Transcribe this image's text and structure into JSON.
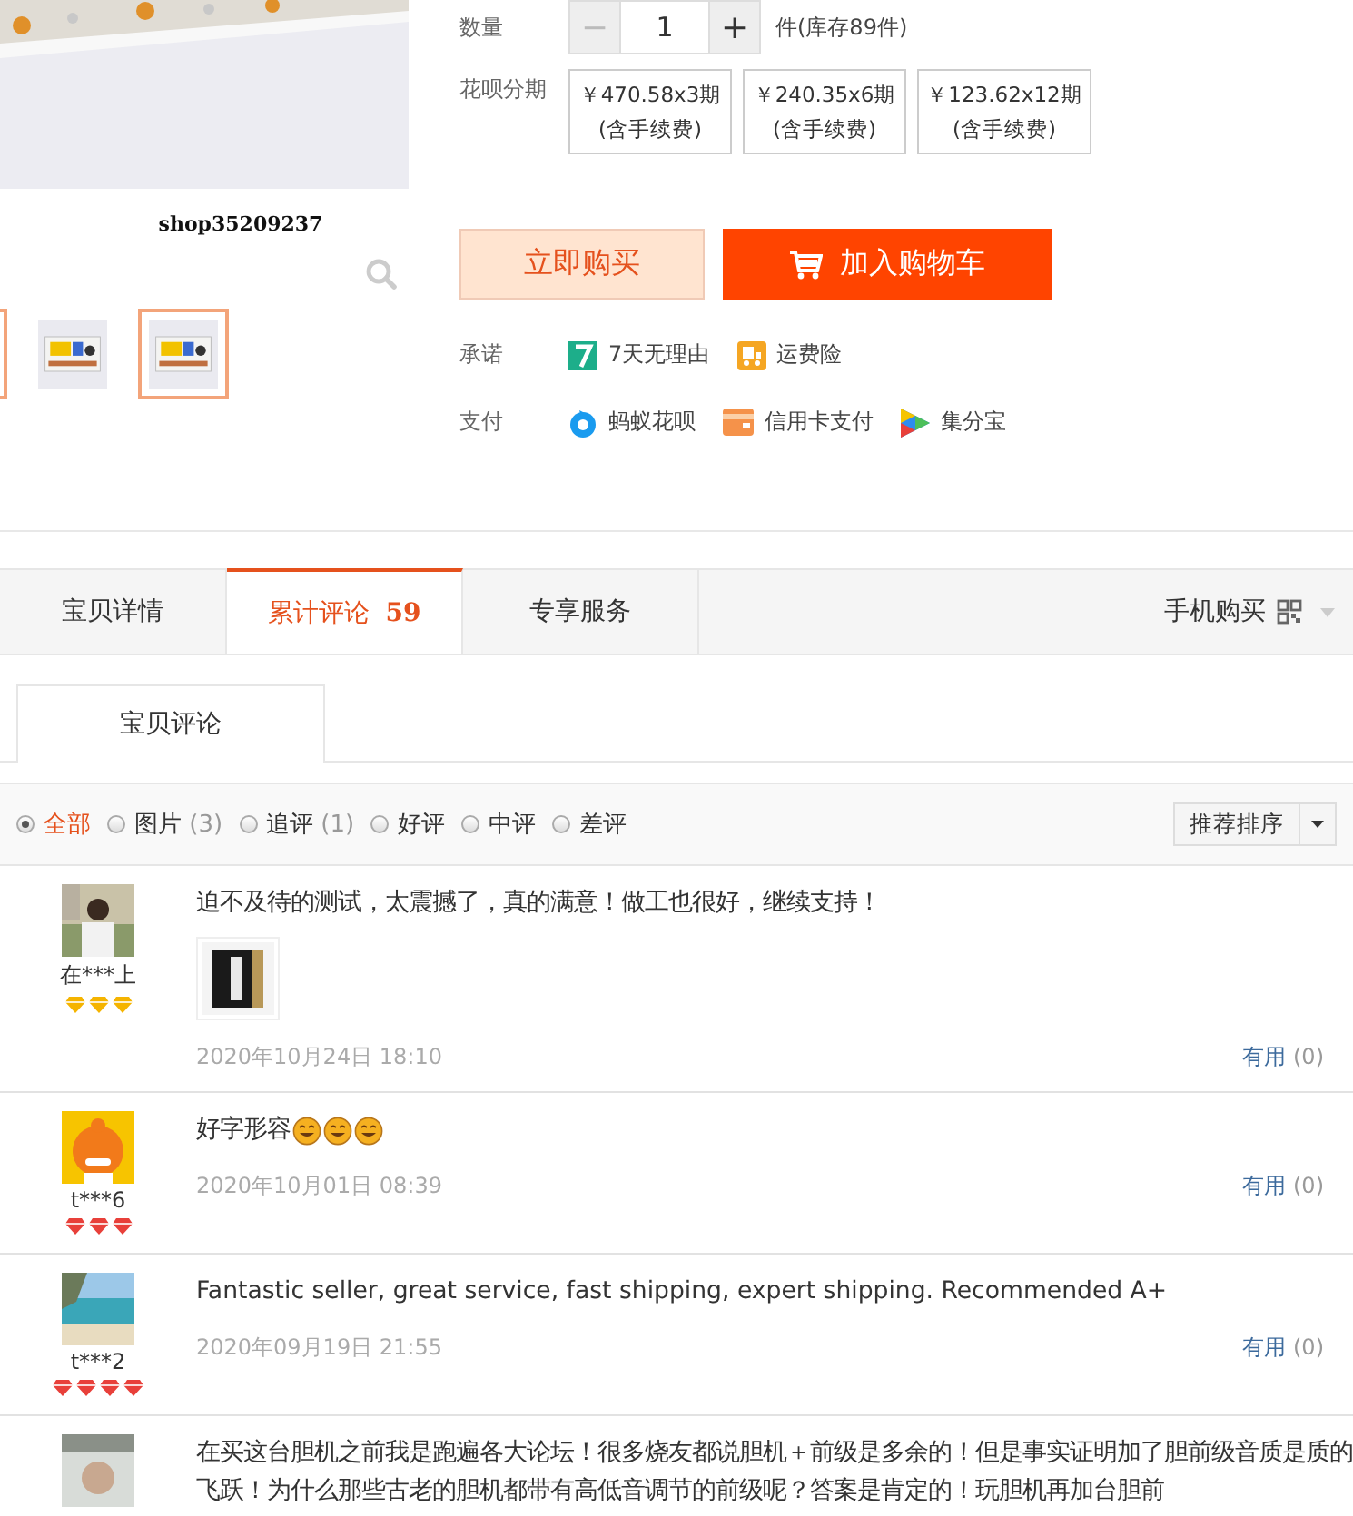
{
  "product": {
    "shop_label": "shop35209237",
    "thumbnails": [
      {
        "selected": true
      },
      {
        "kind": "picture",
        "selected": false
      },
      {
        "kind": "picture",
        "selected": true
      }
    ]
  },
  "quantity": {
    "label": "数量",
    "minus": "−",
    "value": "1",
    "plus": "+",
    "stock": "件(库存89件)"
  },
  "installments": {
    "label": "花呗分期",
    "options": [
      {
        "price": "￥470.58x3期",
        "note": "(含手续费)"
      },
      {
        "price": "￥240.35x6期",
        "note": "(含手续费)"
      },
      {
        "price": "￥123.62x12期",
        "note": "(含手续费)"
      }
    ]
  },
  "buttons": {
    "buy_now": "立即购买",
    "add_to_cart": "加入购物车"
  },
  "promise": {
    "label": "承诺",
    "items": [
      {
        "kind": "seven",
        "text": "7天无理由"
      },
      {
        "kind": "truck",
        "text": "运费险"
      }
    ]
  },
  "payment": {
    "label": "支付",
    "items": [
      {
        "kind": "huabei",
        "text": "蚂蚁花呗"
      },
      {
        "kind": "card",
        "text": "信用卡支付"
      },
      {
        "kind": "jifen",
        "text": "集分宝"
      }
    ]
  },
  "tabs": [
    {
      "label": "宝贝详情",
      "selected": false
    },
    {
      "label": "累计评论",
      "count": "59",
      "selected": true
    },
    {
      "label": "专享服务",
      "selected": false
    }
  ],
  "mobile_buy": "手机购买",
  "subtab": "宝贝评论",
  "filters": [
    {
      "label": "全部",
      "selected": true
    },
    {
      "label": "图片",
      "count": "(3)",
      "selected": false
    },
    {
      "label": "追评",
      "count": "(1)",
      "selected": false
    },
    {
      "label": "好评",
      "selected": false
    },
    {
      "label": "中评",
      "selected": false
    },
    {
      "label": "差评",
      "selected": false
    }
  ],
  "sort": "推荐排序",
  "reviews": [
    {
      "user": "在***上",
      "stars": 3,
      "color": "#f5b400",
      "text": "迫不及待的测试，太震撼了，真的满意！做工也很好，继续支持！",
      "photos": [
        {
          "kind": "picture"
        }
      ],
      "date": "2020年10月24日 18:10",
      "useful": "有用",
      "useful_count": "(0)"
    },
    {
      "user": "t***6",
      "stars": 3,
      "color": "#e8403a",
      "text": "好字形容",
      "emojis": [
        {
          "kind": "grin"
        },
        {
          "kind": "grin"
        },
        {
          "kind": "grin"
        }
      ],
      "date": "2020年10月01日 08:39",
      "useful": "有用",
      "useful_count": "(0)"
    },
    {
      "user": "t***2",
      "stars": 4,
      "color": "#e8403a",
      "text": "Fantastic seller, great service, fast shipping, expert shipping. Recommended A+",
      "date": "2020年09月19日 21:55",
      "useful": "有用",
      "useful_count": "(0)"
    },
    {
      "text": "在买这台胆机之前我是跑遍各大论坛！很多烧友都说胆机＋前级是多余的！但是事实证明加了胆前级音质是质的飞跃！为什么那些古老的胆机都带有高低音调节的前级呢？答案是肯定的！玩胆机再加台胆前"
    }
  ]
}
